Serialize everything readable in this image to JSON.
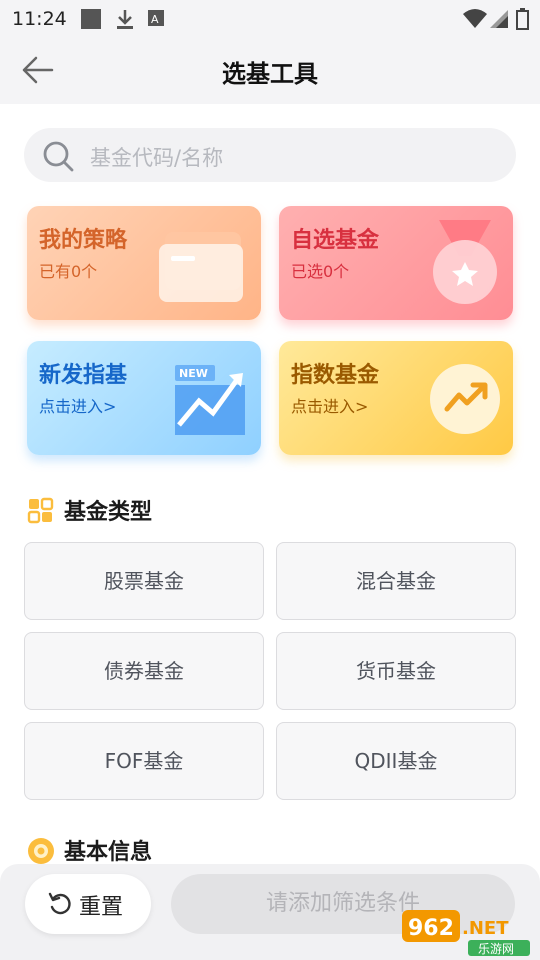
{
  "status_bar": {
    "time": "11:24",
    "icons": [
      "gallery-icon",
      "download-icon",
      "translate-icon",
      "wifi-icon",
      "signal-icon",
      "battery-icon"
    ]
  },
  "header": {
    "title": "选基工具",
    "back_icon": "arrow-left-icon"
  },
  "search": {
    "placeholder": "基金代码/名称"
  },
  "cards": [
    {
      "title": "我的策略",
      "subtitle": "已有0个",
      "icon": "wallet-icon",
      "colors": [
        "#ffd3b6",
        "#ffb487"
      ]
    },
    {
      "title": "自选基金",
      "subtitle": "已选0个",
      "icon": "medal-icon",
      "colors": [
        "#ffb0b0",
        "#ff8d94"
      ]
    },
    {
      "title": "新发指基",
      "subtitle": "点击进入>",
      "icon": "new-chart-icon",
      "colors": [
        "#c6ecff",
        "#8fd0ff"
      ]
    },
    {
      "title": "指数基金",
      "subtitle": "点击进入>",
      "icon": "trend-up-icon",
      "colors": [
        "#ffe99a",
        "#ffc944"
      ]
    }
  ],
  "fund_types": {
    "title": "基金类型",
    "items": [
      "股票基金",
      "混合基金",
      "债券基金",
      "货币基金",
      "FOF基金",
      "QDII基金"
    ]
  },
  "basic_info": {
    "title": "基本信息"
  },
  "bottom_bar": {
    "reset_label": "重置",
    "apply_label": "请添加筛选条件"
  },
  "watermark": {
    "text": "962.NET",
    "subtext": "乐游网"
  }
}
